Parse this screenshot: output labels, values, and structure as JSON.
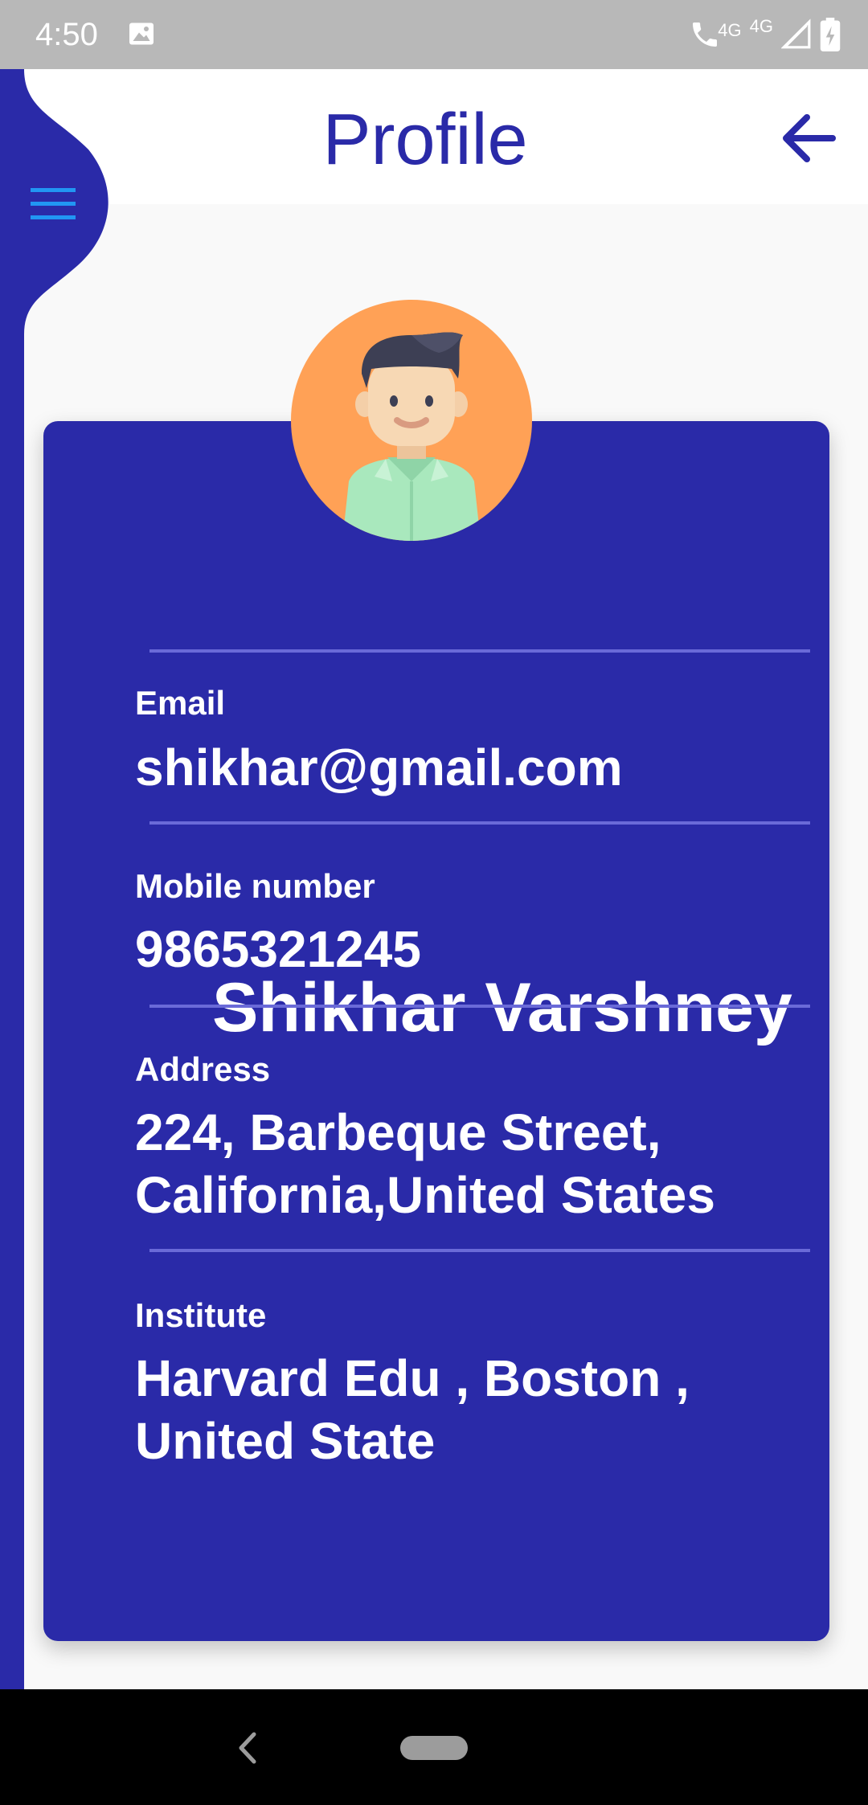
{
  "status_bar": {
    "time": "4:50",
    "network_label": "4G",
    "network_label_2": "4G",
    "icons": [
      "image-icon",
      "wifi-calling-icon",
      "signal-icon",
      "battery-charging-icon"
    ]
  },
  "header": {
    "title": "Profile",
    "back_icon": "arrow-left-icon",
    "menu_icon": "hamburger-menu-icon"
  },
  "profile": {
    "name": "Shikhar Varshney",
    "avatar_icon": "male-avatar-icon",
    "fields": [
      {
        "label": "Email",
        "value": "shikhar@gmail.com"
      },
      {
        "label": "Mobile number",
        "value": "9865321245"
      },
      {
        "label": "Address",
        "value": "224, Barbeque Street,\nCalifornia,United States"
      },
      {
        "label": "Institute",
        "value": "Harvard Edu , Boston ,\nUnited State"
      }
    ]
  },
  "colors": {
    "primary": "#2a2aa8",
    "accent_menu": "#2196f3",
    "avatar_bg": "#ffa156",
    "header_bg": "#ffffff",
    "page_bg": "#f9f9f9",
    "status_bar_bg": "#b8b8b8"
  }
}
